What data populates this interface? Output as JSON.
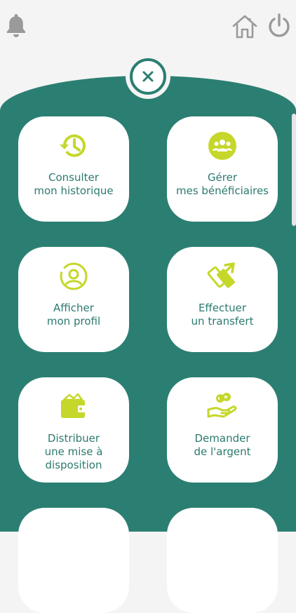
{
  "header": {
    "icons": [
      "bell-icon",
      "home-icon",
      "power-icon"
    ]
  },
  "close_button": {
    "icon": "close-icon"
  },
  "colors": {
    "accent": "#c5d72a",
    "primary": "#2b7f72",
    "text": "#2c7a6f"
  },
  "menu": {
    "items": [
      {
        "line1": "Consulter",
        "line2": "mon historique",
        "icon": "history-icon"
      },
      {
        "line1": "Gérer",
        "line2": "mes bénéficiaires",
        "icon": "beneficiaries-icon"
      },
      {
        "line1": "Afficher",
        "line2": "mon profil",
        "icon": "profile-icon"
      },
      {
        "line1": "Effectuer",
        "line2": "un transfert",
        "icon": "transfer-icon"
      },
      {
        "line1": "Distribuer",
        "line2": "une mise à disposition",
        "icon": "wallet-icon"
      },
      {
        "line1": "Demander",
        "line2": "de l'argent",
        "icon": "request-money-icon"
      }
    ]
  }
}
